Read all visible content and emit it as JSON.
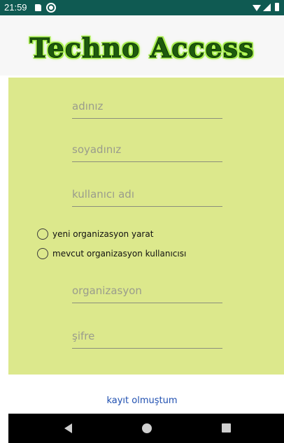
{
  "status_bar": {
    "time": "21:59"
  },
  "header": {
    "title": "Techno Access"
  },
  "form": {
    "name_placeholder": "adınız",
    "surname_placeholder": "soyadınız",
    "username_placeholder": "kullanıcı adı",
    "radio_new_org_label": "yeni organizasyon yarat",
    "radio_existing_org_label": "mevcut organizasyon kullanıcısı",
    "organization_placeholder": "organizasyon",
    "password_placeholder": "şifre"
  },
  "footer": {
    "login_link": "kayıt olmuştum"
  },
  "colors": {
    "status_bar": "#0f5a52",
    "form_background": "#dce88c",
    "logo_text": "#1e5a0e",
    "logo_glow": "#9fe34a",
    "link": "#1f4fb0"
  },
  "icons": [
    "sd-card-icon",
    "sync-icon",
    "wifi-icon",
    "signal-icon",
    "battery-icon",
    "back-icon",
    "home-icon",
    "recents-icon"
  ]
}
